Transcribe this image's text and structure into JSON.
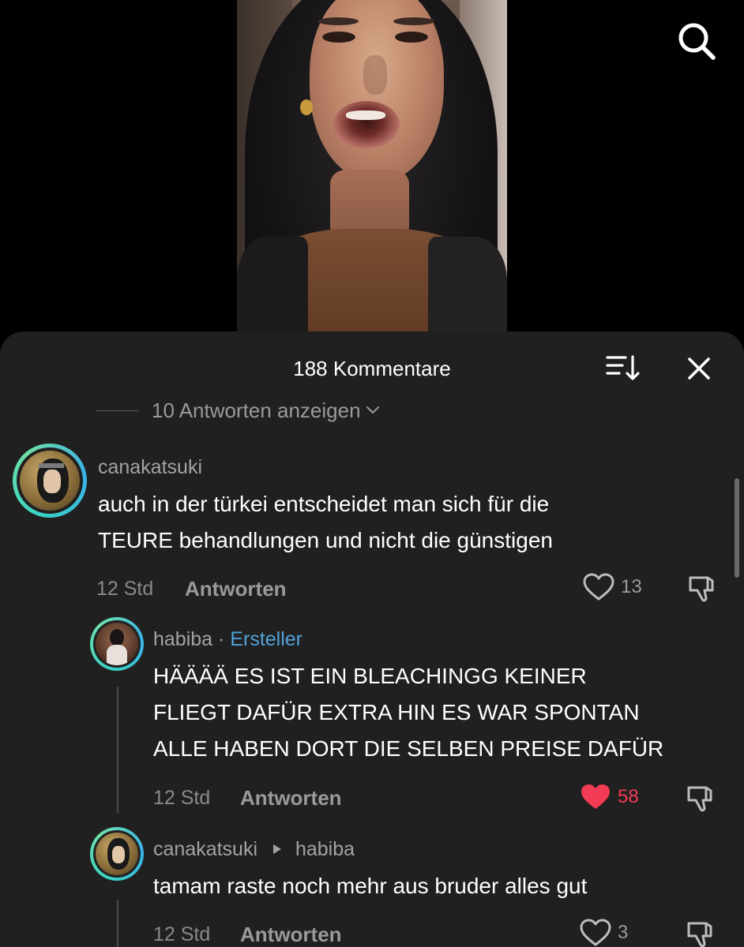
{
  "header": {
    "title": "188 Kommentare"
  },
  "replies_toggle": {
    "label": "10 Antworten anzeigen"
  },
  "comments": [
    {
      "username": "canakatsuki",
      "text_lines": [
        "auch in der türkei entscheidet man sich für die",
        "TEURE behandlungen und nicht die günstigen"
      ],
      "time": "12 Std",
      "reply_label": "Antworten",
      "likes": "13",
      "liked": false
    },
    {
      "username": "habiba",
      "separator": "·",
      "creator_badge": "Ersteller",
      "text_lines": [
        "HÄÄÄÄ ES IST EIN BLEACHINGG KEINER",
        "FLIEGT DAFÜR EXTRA HIN ES WAR SPONTAN",
        "ALLE HABEN DORT DIE SELBEN PREISE DAFÜR"
      ],
      "time": "12 Std",
      "reply_label": "Antworten",
      "likes": "58",
      "liked": true
    },
    {
      "username": "canakatsuki",
      "reply_to": "habiba",
      "text_lines": [
        "tamam raste noch mehr aus bruder alles gut"
      ],
      "time": "12 Std",
      "reply_label": "Antworten",
      "likes": "3",
      "liked": false
    }
  ],
  "colors": {
    "sheet_bg": "#202020",
    "like_active": "#f23b54",
    "creator": "#4fa3d8"
  },
  "icons": [
    "search-icon",
    "sort-icon",
    "close-icon",
    "chevron-down-icon",
    "heart-icon",
    "dislike-icon",
    "reply-arrow-icon"
  ]
}
